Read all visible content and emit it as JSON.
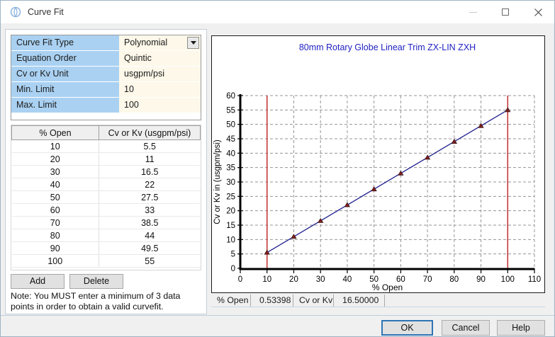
{
  "window": {
    "title": "Curve Fit"
  },
  "form": {
    "rows": [
      {
        "label": "Curve Fit Type",
        "value": "Polynomial"
      },
      {
        "label": "Equation Order",
        "value": "Quintic"
      },
      {
        "label": "Cv or Kv Unit",
        "value": "usgpm/psi"
      },
      {
        "label": "Min. Limit",
        "value": "10"
      },
      {
        "label": "Max. Limit",
        "value": "100"
      }
    ]
  },
  "table": {
    "headers": [
      "% Open",
      "Cv or Kv (usgpm/psi)"
    ],
    "rows": [
      [
        10,
        5.5
      ],
      [
        20,
        11
      ],
      [
        30,
        16.5
      ],
      [
        40,
        22
      ],
      [
        50,
        27.5
      ],
      [
        60,
        33
      ],
      [
        70,
        38.5
      ],
      [
        80,
        44
      ],
      [
        90,
        49.5
      ],
      [
        100,
        55
      ]
    ]
  },
  "buttons": {
    "add": "Add",
    "delete": "Delete",
    "ok": "OK",
    "cancel": "Cancel",
    "help": "Help"
  },
  "note": "Note: You MUST enter a minimum of 3 data points in order to obtain a valid curvefit.",
  "status_bar": {
    "items": [
      "% Open",
      "0.53398",
      "Cv or Kv",
      "16.50000"
    ]
  },
  "chart_data": {
    "type": "line",
    "title": "80mm Rotary Globe Linear Trim ZX-LIN ZXH",
    "xlabel": "% Open",
    "ylabel": "Cv or Kv in (usgpm/psi)",
    "x": [
      10,
      20,
      30,
      40,
      50,
      60,
      70,
      80,
      90,
      100
    ],
    "y": [
      5.5,
      11,
      16.5,
      22,
      27.5,
      33,
      38.5,
      44,
      49.5,
      55
    ],
    "xlim": [
      0,
      110
    ],
    "ylim": [
      0,
      60
    ],
    "xticks": [
      0,
      10,
      20,
      30,
      40,
      50,
      60,
      70,
      80,
      90,
      100,
      110
    ],
    "yticks": [
      0,
      5,
      10,
      15,
      20,
      25,
      30,
      35,
      40,
      45,
      50,
      55,
      60
    ],
    "limit_lines_x": [
      10,
      100
    ],
    "grid": true,
    "legend": "none",
    "title_color": "#2222c2",
    "line_color": "#1f1f8f",
    "marker_color": "#7c1f1f",
    "limit_color": "#c23030",
    "grid_color": "#949494"
  }
}
